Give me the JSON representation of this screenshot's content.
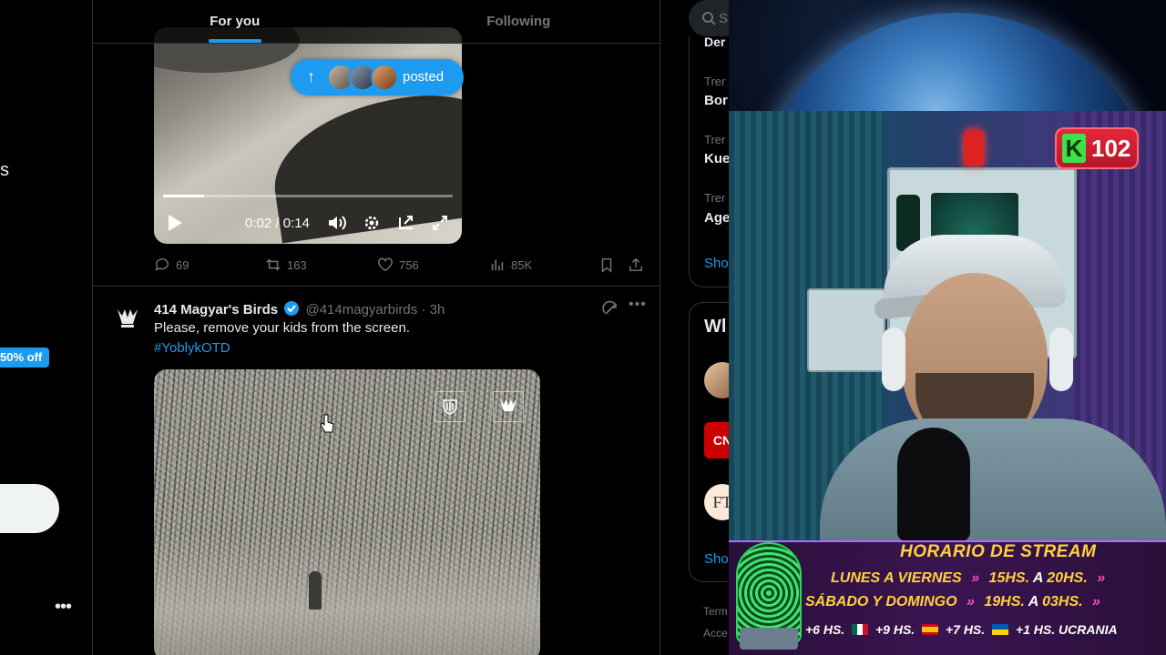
{
  "left_sidebar": {
    "partial_label": "s",
    "promo_label": "50% off",
    "more_label": "•••"
  },
  "tabs": [
    {
      "label": "For you",
      "active": true
    },
    {
      "label": "Following",
      "active": false
    }
  ],
  "video": {
    "posted_label": "posted",
    "time_label": "0:02 / 0:14",
    "progress_percent": 14
  },
  "first_post_actions": {
    "replies": "69",
    "reposts": "163",
    "likes": "756",
    "views": "85K"
  },
  "tweet": {
    "author": "414 Magyar's Birds",
    "handle": "@414magyarbirds",
    "separator": "·",
    "time": "3h",
    "text": "Please, remove your kids from the screen.",
    "hashtag": "#YoblykOTD"
  },
  "right_sidebar": {
    "search_partial": "S",
    "top_partial": "Der",
    "trends": [
      {
        "label": "Trer",
        "title": "Bor"
      },
      {
        "label": "Trer",
        "title": "Kue"
      },
      {
        "label": "Trer",
        "title": "Age"
      }
    ],
    "show_more_1": "Sho",
    "who_title": "Wl",
    "cnn_label": "CN",
    "ft_label": "FT",
    "show_more_2": "Sho",
    "footer_1": "Term",
    "footer_2": "Acce"
  },
  "overlay": {
    "badge_letter": "K",
    "badge_number": "102",
    "banner_title": "HORARIO DE STREAM",
    "schedule": [
      {
        "days": "LUNES A VIERNES",
        "from": "15HS.",
        "to_word": "A",
        "to": "20HS."
      },
      {
        "days": "SÁBADO Y DOMINGO",
        "from": "19HS.",
        "to_word": "A",
        "to": "03HS."
      }
    ],
    "zones": [
      "+6 HS.",
      "+9 HS.",
      "+7 HS.",
      "+1 HS. UCRANIA"
    ]
  },
  "colors": {
    "accent": "#1d9bf0",
    "background": "#000000",
    "text_primary": "#e7e9ea",
    "text_secondary": "#71767b",
    "banner_yellow": "#ffd23a"
  }
}
